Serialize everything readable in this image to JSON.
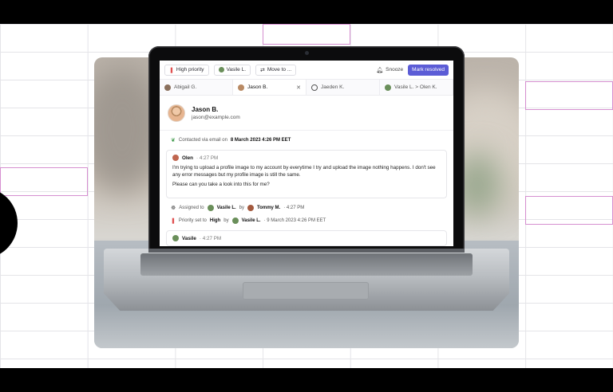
{
  "toolbar": {
    "priority_label": "High priority",
    "assignee_label": "Vasile L.",
    "move_label": "Move to ...",
    "snooze_label": "Snooze",
    "resolve_label": "Mark resolved"
  },
  "tabs": [
    {
      "label": "Abigail G."
    },
    {
      "label": "Jason B.",
      "close": "✕"
    },
    {
      "label": "Jaeden K."
    },
    {
      "label": "Vasile L. > Olen K."
    }
  ],
  "contact": {
    "name": "Jason B.",
    "email": "jason@example.com"
  },
  "events": {
    "contacted_prefix": "Contacted via email on",
    "contacted_date": "8 March 2023 4:26 PM EET",
    "assigned_prefix": "Assigned to",
    "assigned_to": "Vasile L.",
    "by": "by",
    "assigned_by": "Tommy M.",
    "assigned_time": "· 4:27 PM",
    "priority_prefix": "Priority set to",
    "priority_value": "High",
    "priority_by": "Vasile L.",
    "priority_time": "· 9 March 2023 4:26 PM EET"
  },
  "message": {
    "author": "Olen",
    "time": "· 4:27 PM",
    "para1": "I'm trying to upload a profile image to my account by everytime I try and upload the image nothing happens. I don't see any error messages but my profile image is still the same.",
    "para2": "Please can you take a look into this for me?"
  },
  "message2": {
    "author": "Vasile",
    "time": "· 4:27 PM"
  },
  "colors": {
    "accent": "#5b5cd6",
    "grid_highlight": "#d58fd0"
  }
}
